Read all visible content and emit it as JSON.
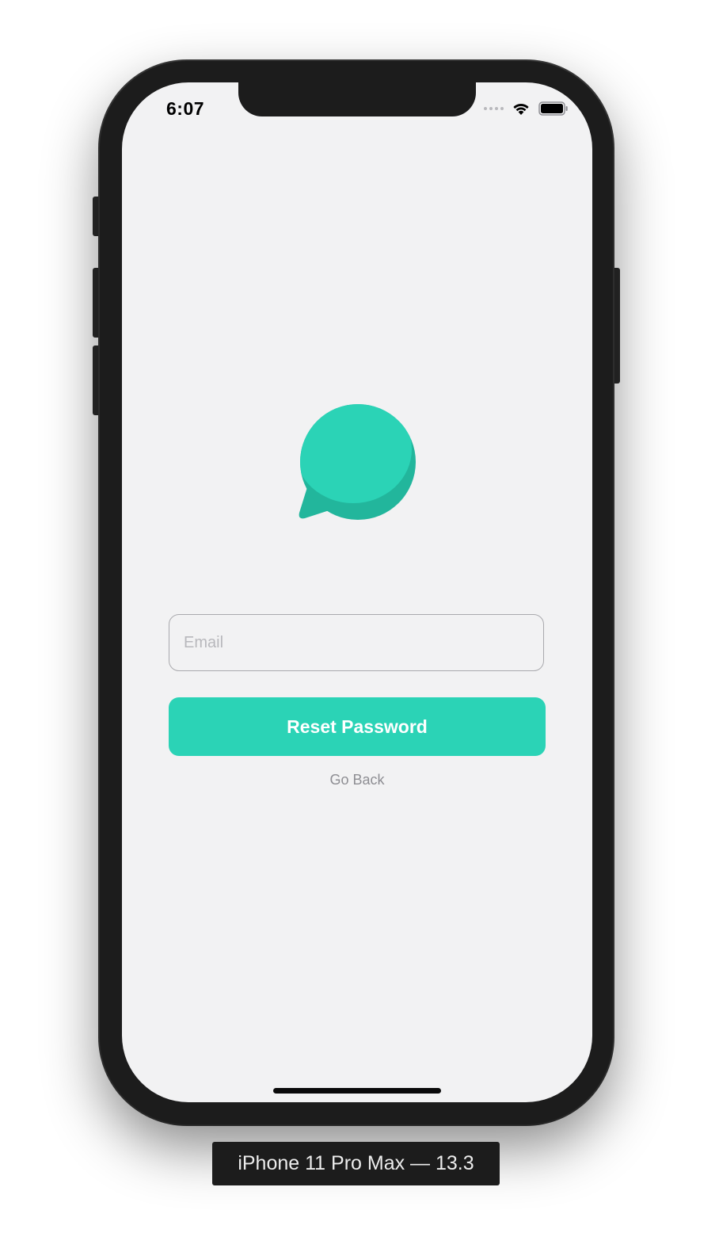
{
  "status_bar": {
    "time": "6:07",
    "icons": [
      "cellular-signal-icon",
      "wifi-icon",
      "battery-icon"
    ]
  },
  "logo": {
    "icon": "chat-bubble-icon",
    "colors": {
      "primary": "#2bd3b6",
      "shade": "#22b69c"
    }
  },
  "form": {
    "email_placeholder": "Email",
    "email_value": "",
    "reset_button_label": "Reset Password",
    "go_back_label": "Go Back"
  },
  "theme": {
    "accent": "#2bd3b6",
    "background": "#f2f2f3",
    "muted_text": "#8e8e93"
  },
  "device_label": "iPhone 11 Pro Max — 13.3"
}
